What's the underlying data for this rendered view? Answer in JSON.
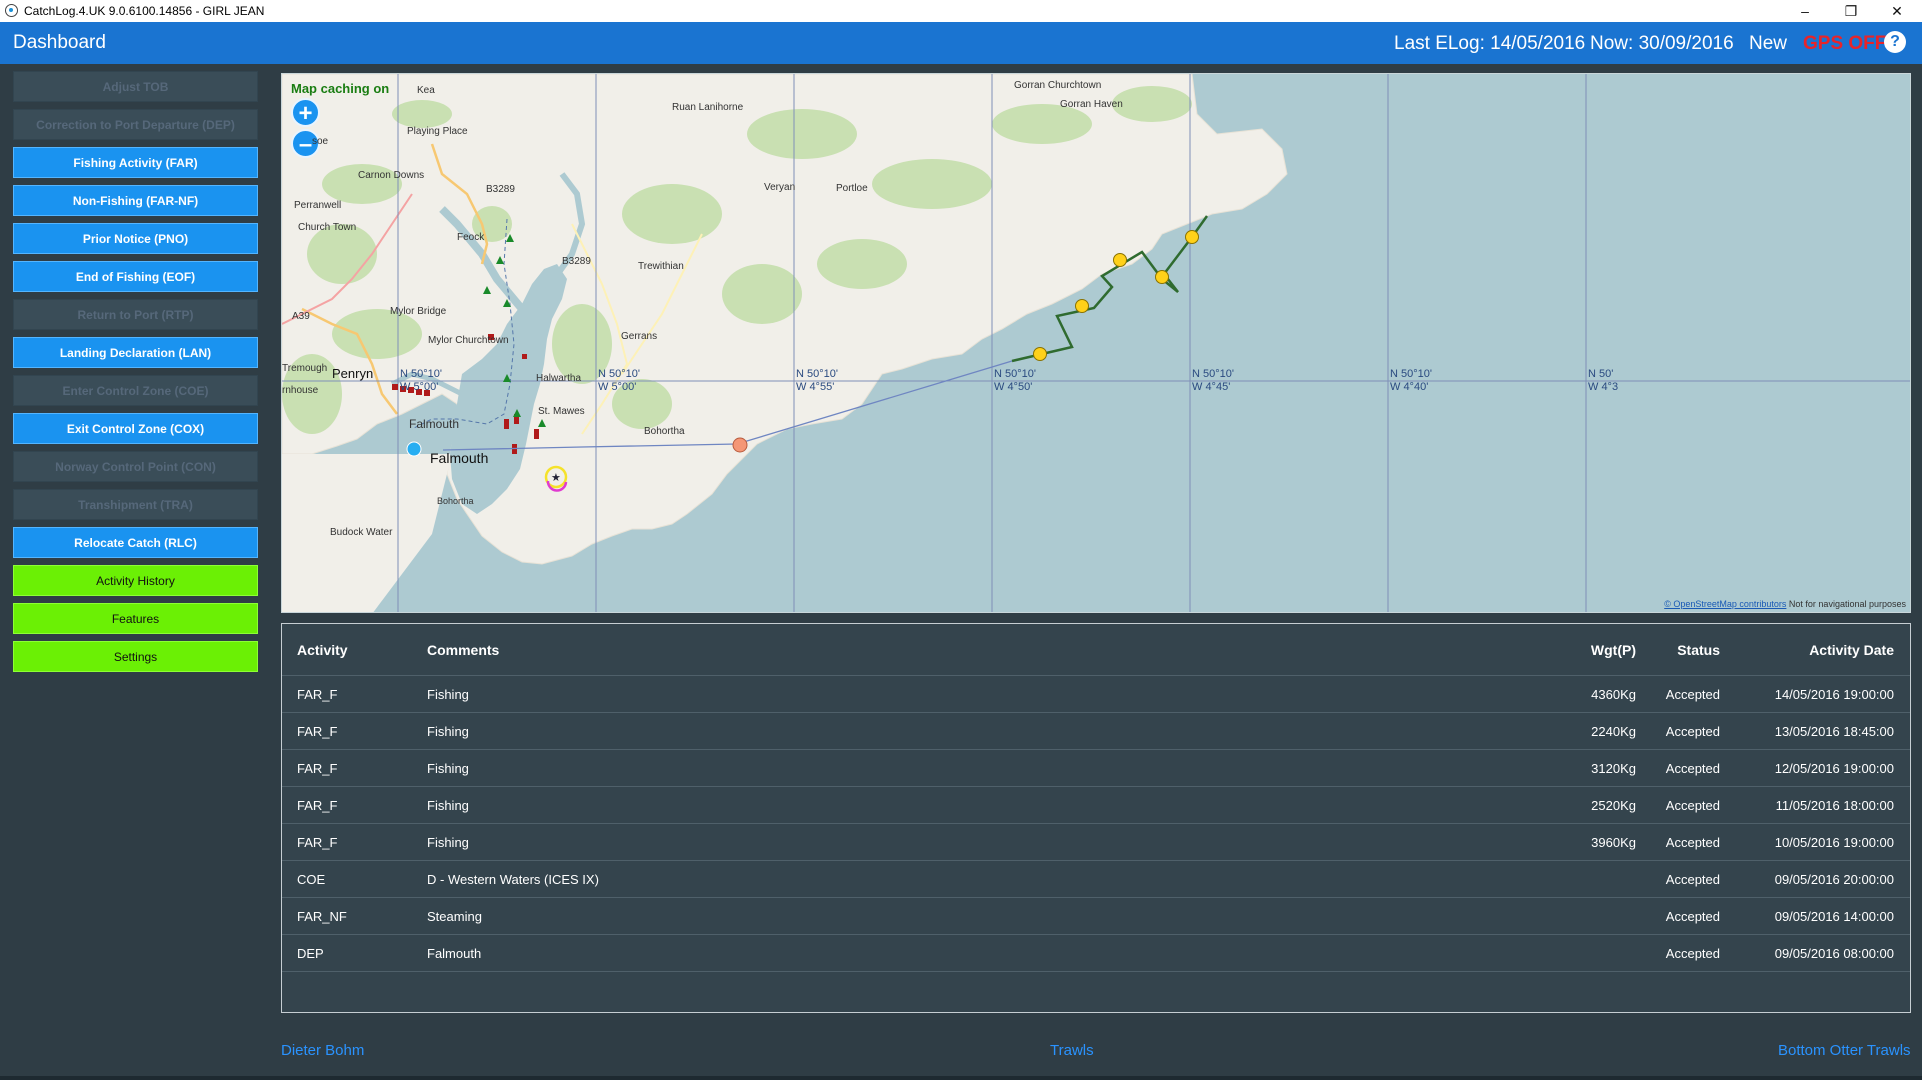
{
  "window": {
    "title": "CatchLog.4.UK 9.0.6100.14856  -  GIRL JEAN",
    "minimize": "–",
    "restore": "❐",
    "close": "✕"
  },
  "header": {
    "title": "Dashboard",
    "last_elog": "Last ELog: 14/05/2016",
    "now": "Now: 30/09/2016",
    "new_label": "New",
    "gps_status": "GPS OFF",
    "help": "?"
  },
  "sidebar": {
    "buttons": [
      {
        "label": "Adjust TOB",
        "state": "disabled"
      },
      {
        "label": "Correction to Port Departure (DEP)",
        "state": "disabled"
      },
      {
        "label": "Fishing Activity (FAR)",
        "state": "active"
      },
      {
        "label": "Non-Fishing (FAR-NF)",
        "state": "active"
      },
      {
        "label": "Prior Notice (PNO)",
        "state": "active"
      },
      {
        "label": "End of Fishing (EOF)",
        "state": "active"
      },
      {
        "label": "Return to Port (RTP)",
        "state": "disabled"
      },
      {
        "label": "Landing Declaration (LAN)",
        "state": "active"
      },
      {
        "label": "Enter Control Zone (COE)",
        "state": "disabled"
      },
      {
        "label": "Exit Control Zone (COX)",
        "state": "active"
      },
      {
        "label": "Norway Control Point (CON)",
        "state": "disabled"
      },
      {
        "label": "Transhipment (TRA)",
        "state": "disabled"
      },
      {
        "label": "Relocate Catch (RLC)",
        "state": "active"
      },
      {
        "label": "Activity History",
        "state": "green"
      },
      {
        "label": "Features",
        "state": "green"
      },
      {
        "label": "Settings",
        "state": "green"
      }
    ]
  },
  "map": {
    "caching_label": "Map caching on",
    "zoom_in": "+",
    "zoom_out": "–",
    "places": {
      "kea": "Kea",
      "ruan": "Ruan Lanihorne",
      "gorran_churchtown": "Gorran Churchtown",
      "gorran_haven": "Gorran Haven",
      "playing_place": "Playing Place",
      "carnon_downs": "Carnon Downs",
      "perranwell": "Perranwell",
      "church_town": "Church Town",
      "soe": "soe",
      "feock": "Feock",
      "veryan": "Veryan",
      "portloe": "Portloe",
      "trewithian": "Trewithian",
      "mylor_bridge": "Mylor Bridge",
      "mylor_churchtown": "Mylor Churchtown",
      "gerrans": "Gerrans",
      "tremough": "Tremough",
      "penryn": "Penryn",
      "rnhouse": "rnhouse",
      "halwartha": "Halwartha",
      "st_mawes": "St. Mawes",
      "falmouth_small": "Falmouth",
      "falmouth_big": "Falmouth",
      "budock": "Budock Water",
      "bohortha": "Bohortha",
      "b3289a": "B3289",
      "b3289b": "B3289",
      "a39": "A39"
    },
    "grid_labels": [
      {
        "lat": "N 50°10'",
        "lon": "W 5°00'"
      },
      {
        "lat": "N 50°10'",
        "lon": "W 5°00'"
      },
      {
        "lat": "N 50°10'",
        "lon": "W 4°55'"
      },
      {
        "lat": "N 50°10'",
        "lon": "W 4°50'"
      },
      {
        "lat": "N 50°10'",
        "lon": "W 4°45'"
      },
      {
        "lat": "N 50°10'",
        "lon": "W 4°40'"
      },
      {
        "lat": "N 50'",
        "lon": "W 4°3"
      }
    ],
    "attribution_link": "© OpenStreetMap contributors",
    "attribution_text": "Not for navigational purposes",
    "colors": {
      "sea": "#adcad1",
      "land": "#f1efe9",
      "trawl_line": "#2f6b2f",
      "haul_marker": "#ffd11a",
      "start_marker": "#27aef2",
      "waypoint_marker": "#f49777"
    }
  },
  "table": {
    "headers": {
      "activity": "Activity",
      "comments": "Comments",
      "weight": "Wgt(P)",
      "status": "Status",
      "date": "Activity Date"
    },
    "rows": [
      {
        "activity": "FAR_F",
        "comments": "Fishing",
        "weight": "4360Kg",
        "status": "Accepted",
        "date": "14/05/2016 19:00:00"
      },
      {
        "activity": "FAR_F",
        "comments": "Fishing",
        "weight": "2240Kg",
        "status": "Accepted",
        "date": "13/05/2016 18:45:00"
      },
      {
        "activity": "FAR_F",
        "comments": "Fishing",
        "weight": "3120Kg",
        "status": "Accepted",
        "date": "12/05/2016 19:00:00"
      },
      {
        "activity": "FAR_F",
        "comments": "Fishing",
        "weight": "2520Kg",
        "status": "Accepted",
        "date": "11/05/2016 18:00:00"
      },
      {
        "activity": "FAR_F",
        "comments": "Fishing",
        "weight": "3960Kg",
        "status": "Accepted",
        "date": "10/05/2016 19:00:00"
      },
      {
        "activity": "COE",
        "comments": "D - Western Waters (ICES IX)",
        "weight": "",
        "status": "Accepted",
        "date": "09/05/2016 20:00:00"
      },
      {
        "activity": "FAR_NF",
        "comments": "Steaming",
        "weight": "",
        "status": "Accepted",
        "date": "09/05/2016 14:00:00"
      },
      {
        "activity": "DEP",
        "comments": "Falmouth",
        "weight": "",
        "status": "Accepted",
        "date": "09/05/2016 08:00:00"
      }
    ]
  },
  "footer": {
    "skipper": "Dieter Bohm",
    "gear_type": "Trawls",
    "gear_name": "Bottom Otter Trawls"
  }
}
